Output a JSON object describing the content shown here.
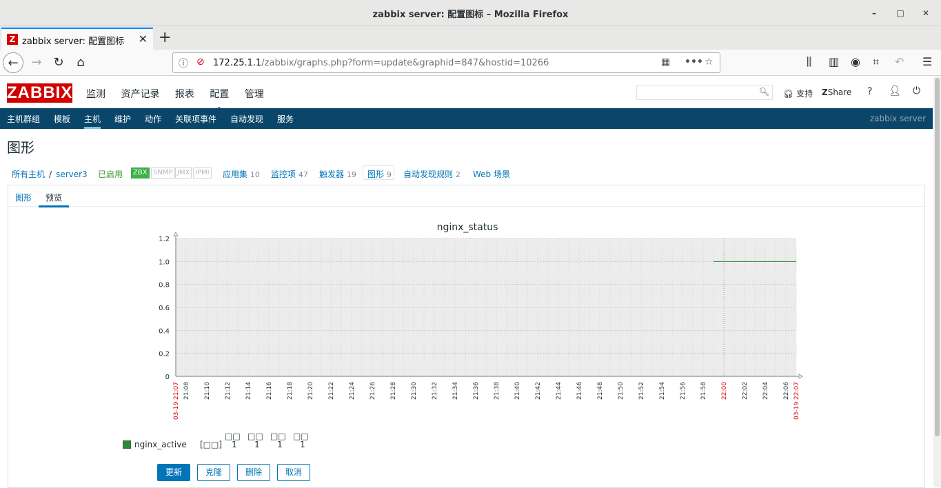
{
  "window": {
    "title": "zabbix server: 配置图标 – Mozilla Firefox"
  },
  "tab": {
    "title": "zabbix server: 配置图标",
    "favicon": "Z"
  },
  "urlbar": {
    "host": "172.25.1.1",
    "path": "/zabbix/graphs.php?form=update&graphid=847&hostid=10266"
  },
  "header": {
    "logo": "ZABBIX",
    "menu": [
      "监测",
      "资产记录",
      "报表",
      "配置",
      "管理"
    ],
    "active_menu": "配置",
    "support": "支持",
    "share": "Share",
    "help": "?"
  },
  "submenu": {
    "items": [
      "主机群组",
      "模板",
      "主机",
      "维护",
      "动作",
      "关联项事件",
      "自动发现",
      "服务"
    ],
    "selected": "主机",
    "server_name": "zabbix server"
  },
  "page": {
    "title": "图形",
    "breadcrumb_all_hosts": "所有主机",
    "breadcrumb_sep": "/",
    "breadcrumb_host": "server3",
    "enabled": "已启用",
    "tags": [
      "ZBX",
      "SNMP",
      "JMX",
      "IPMI"
    ],
    "links": [
      {
        "label": "应用集",
        "count": "10"
      },
      {
        "label": "监控项",
        "count": "47"
      },
      {
        "label": "触发器",
        "count": "19"
      },
      {
        "label": "图形",
        "count": "9"
      },
      {
        "label": "自动发现规则",
        "count": "2"
      },
      {
        "label": "Web 场景",
        "count": ""
      }
    ],
    "tabs": [
      "图形",
      "预览"
    ]
  },
  "chart_data": {
    "type": "line",
    "title": "nginx_status",
    "yticks": [
      "1.2",
      "1.0",
      "0.8",
      "0.6",
      "0.4",
      "0.2",
      "0"
    ],
    "ylim": [
      0,
      1.2
    ],
    "xticks": [
      "21:08",
      "21:10",
      "21:12",
      "21:14",
      "21:16",
      "21:18",
      "21:20",
      "21:22",
      "21:24",
      "21:26",
      "21:28",
      "21:30",
      "21:32",
      "21:34",
      "21:36",
      "21:38",
      "21:40",
      "21:42",
      "21:44",
      "21:46",
      "21:48",
      "21:50",
      "21:52",
      "21:54",
      "21:56",
      "21:58",
      "22:00",
      "22:02",
      "22:04",
      "22:06"
    ],
    "x_start_label": "03-19 21:07",
    "x_end_label": "03-19 22:07",
    "highlight_tick": "22:00",
    "series": [
      {
        "name": "nginx_active",
        "color": "#2a8c32",
        "x": [
          "21:59",
          "22:07"
        ],
        "values": [
          1,
          1
        ]
      }
    ],
    "grid": true
  },
  "legend": {
    "name": "nginx_active",
    "bracket": "[□□]",
    "headers": [
      "□□",
      "□□",
      "□□",
      "□□"
    ],
    "values": [
      "1",
      "1",
      "1",
      "1"
    ]
  },
  "buttons": {
    "update": "更新",
    "clone": "克隆",
    "delete": "删除",
    "cancel": "取消"
  }
}
